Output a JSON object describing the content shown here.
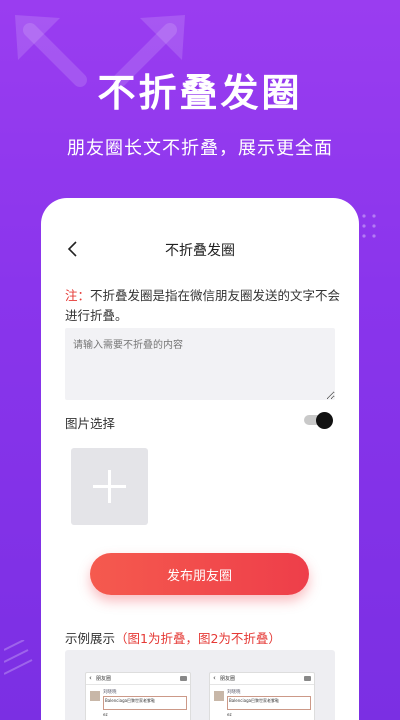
{
  "promo": {
    "headline": "不折叠发圈",
    "subline": "朋友圈长文不折叠，展示更全面"
  },
  "screen": {
    "nav_title": "不折叠发圈",
    "note_prefix": "注：",
    "note_text": "不折叠发圈是指在微信朋友圈发送的文字不会进行折叠。",
    "input_placeholder": "请输入需要不折叠的内容",
    "image_select_label": "图片选择",
    "image_toggle_on": true,
    "publish_label": "发布朋友圈",
    "example_label": "示例展示",
    "example_hint": "（图1为折叠，图2为不折叠）",
    "examples": [
      {
        "title": "朋友圈",
        "name": "刘晓晓",
        "quote": "Balenciaga巴黎世家老爹鞋",
        "sig": "ez"
      },
      {
        "title": "朋友圈",
        "name": "刘晓晓",
        "quote": "Balenciaga巴黎世家老爹鞋",
        "sig": "ez"
      }
    ]
  },
  "colors": {
    "background": "#8a35ec",
    "accent_red": "#e53935",
    "button": "#f24c4c"
  }
}
